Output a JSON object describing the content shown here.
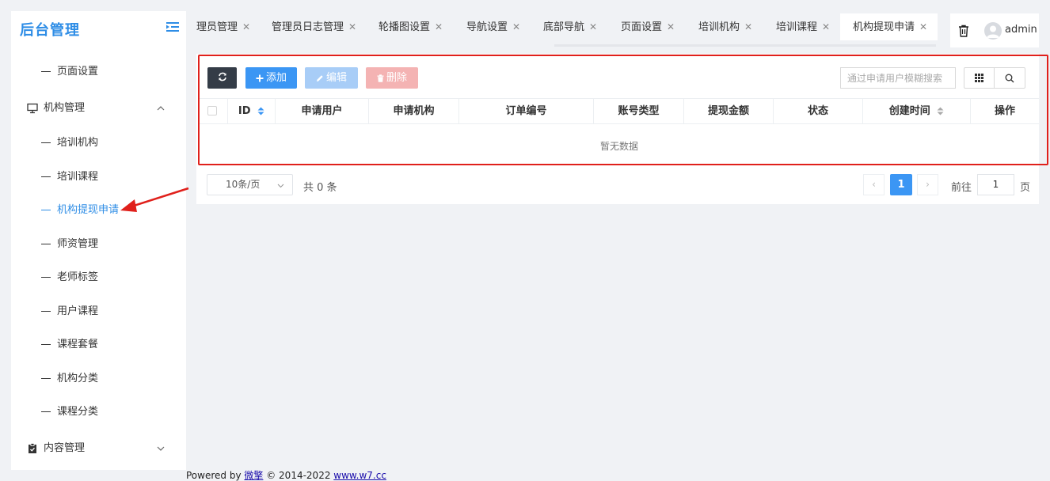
{
  "app": {
    "title": "后台管理"
  },
  "sidebar": {
    "top_item": "页面设置",
    "groups": [
      {
        "label": "机构管理",
        "icon": "monitor-icon",
        "expanded": true
      },
      {
        "label": "内容管理",
        "icon": "clipboard-icon",
        "expanded": false
      }
    ],
    "items": [
      "培训机构",
      "培训课程",
      "机构提现申请",
      "师资管理",
      "老师标签",
      "用户课程",
      "课程套餐",
      "机构分类",
      "课程分类"
    ],
    "active_item": "机构提现申请"
  },
  "tabs": [
    {
      "label": "理员管理"
    },
    {
      "label": "管理员日志管理"
    },
    {
      "label": "轮播图设置"
    },
    {
      "label": "导航设置"
    },
    {
      "label": "底部导航"
    },
    {
      "label": "页面设置"
    },
    {
      "label": "培训机构"
    },
    {
      "label": "培训课程"
    },
    {
      "label": "机构提现申请",
      "active": true
    }
  ],
  "header": {
    "username": "admin"
  },
  "toolbar": {
    "add_label": "添加",
    "edit_label": "编辑",
    "delete_label": "删除",
    "search_placeholder": "通过申请用户模糊搜索"
  },
  "table": {
    "columns": [
      "ID",
      "申请用户",
      "申请机构",
      "订单编号",
      "账号类型",
      "提现金额",
      "状态",
      "创建时间",
      "操作"
    ],
    "rows": [],
    "empty_text": "暂无数据"
  },
  "pagination": {
    "page_size": "10条/页",
    "total": "共 0 条",
    "current_page": "1",
    "goto_label": "前往",
    "goto_value": "1",
    "page_suffix": "页"
  },
  "footer": {
    "powered_by": "Powered by",
    "brand": "微擎",
    "copyright": "© 2014-2022",
    "link": "www.w7.cc"
  },
  "colors": {
    "accent": "#3b96f4",
    "highlight": "#e0201b",
    "dark": "#343c47"
  }
}
